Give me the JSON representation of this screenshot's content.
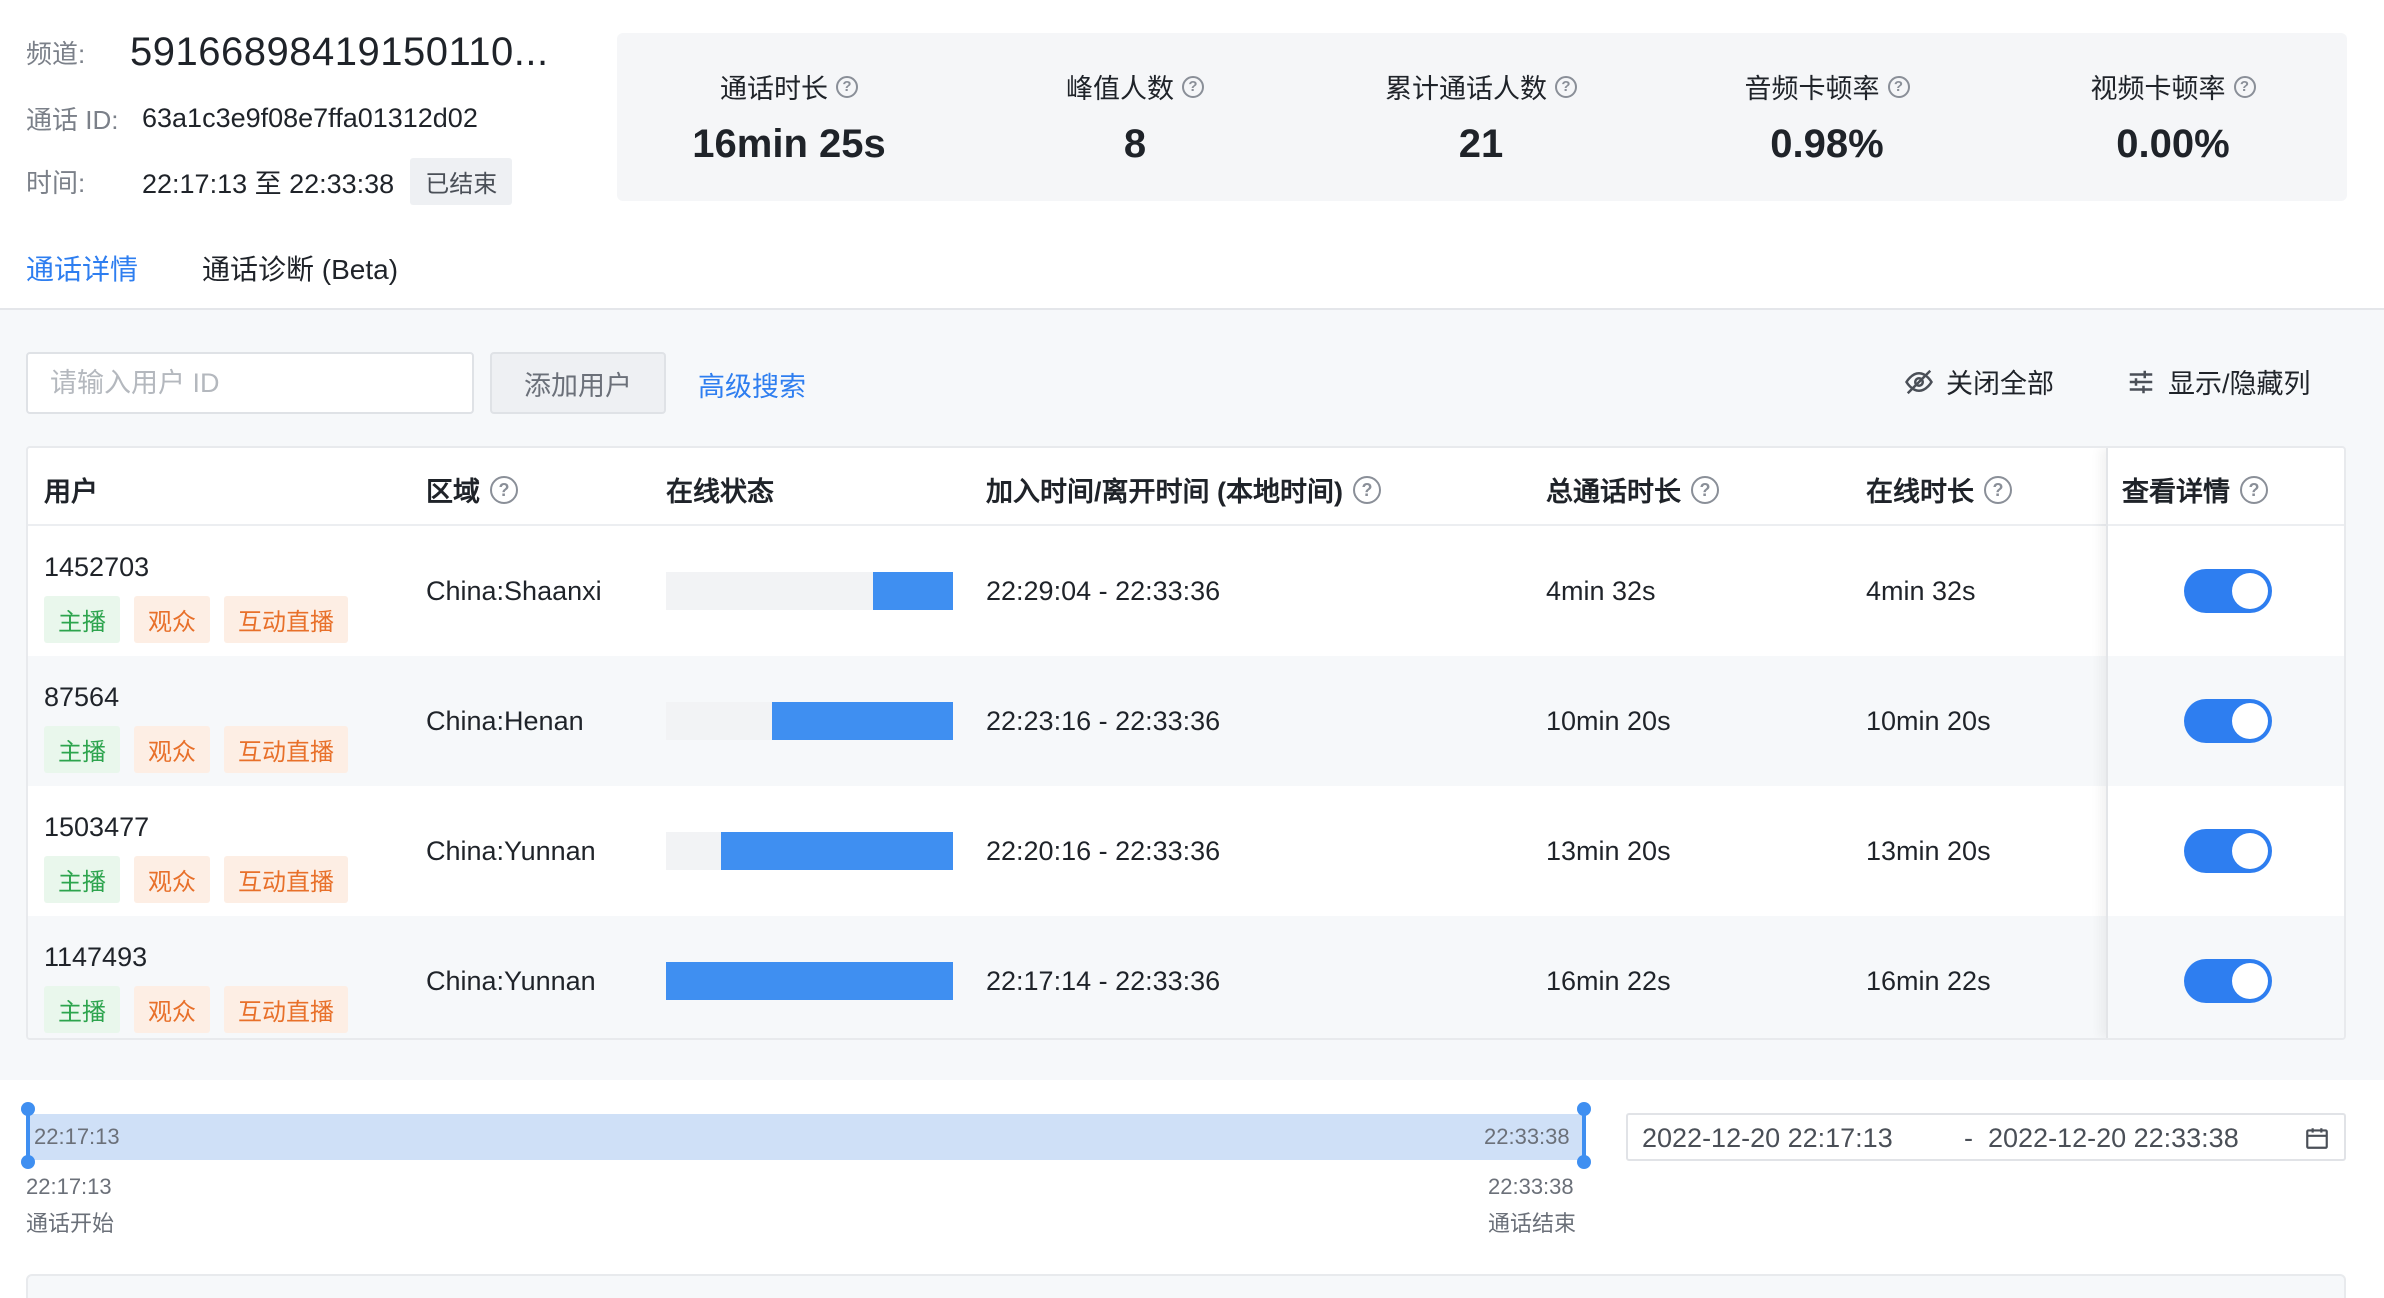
{
  "meta": {
    "channel_label": "频道:",
    "channel_value": "59166898419150110...",
    "call_id_label": "通话 ID:",
    "call_id_value": "63a1c3e9f08e7ffa01312d02",
    "time_label": "时间:",
    "time_value": "22:17:13 至 22:33:38",
    "status": "已结束"
  },
  "stats": [
    {
      "label": "通话时长",
      "value": "16min 25s"
    },
    {
      "label": "峰值人数",
      "value": "8"
    },
    {
      "label": "累计通话人数",
      "value": "21"
    },
    {
      "label": "音频卡顿率",
      "value": "0.98%"
    },
    {
      "label": "视频卡顿率",
      "value": "0.00%"
    }
  ],
  "tabs": [
    {
      "label": "通话详情",
      "active": true
    },
    {
      "label": "通话诊断 (Beta)",
      "active": false
    }
  ],
  "toolbar": {
    "search_placeholder": "请输入用户 ID",
    "add_user": "添加用户",
    "advanced_search": "高级搜索",
    "close_all": "关闭全部",
    "show_hide_columns": "显示/隐藏列"
  },
  "table": {
    "headers": {
      "user": "用户",
      "region": "区域",
      "online_status": "在线状态",
      "join_leave": "加入时间/离开时间 (本地时间)",
      "total_duration": "总通话时长",
      "online_duration": "在线时长",
      "details": "查看详情"
    },
    "rows": [
      {
        "user": "1452703",
        "tags": [
          "主播",
          "观众",
          "互动直播"
        ],
        "region": "China:Shaanxi",
        "online_fraction": 0.28,
        "join_leave": "22:29:04 - 22:33:36",
        "total": "4min 32s",
        "online": "4min 32s",
        "details_on": true
      },
      {
        "user": "87564",
        "tags": [
          "主播",
          "观众",
          "互动直播"
        ],
        "region": "China:Henan",
        "online_fraction": 0.63,
        "join_leave": "22:23:16 - 22:33:36",
        "total": "10min 20s",
        "online": "10min 20s",
        "details_on": true
      },
      {
        "user": "1503477",
        "tags": [
          "主播",
          "观众",
          "互动直播"
        ],
        "region": "China:Yunnan",
        "online_fraction": 0.81,
        "join_leave": "22:20:16 - 22:33:36",
        "total": "13min 20s",
        "online": "13min 20s",
        "details_on": true
      },
      {
        "user": "1147493",
        "tags": [
          "主播",
          "观众",
          "互动直播"
        ],
        "region": "China:Yunnan",
        "online_fraction": 1.0,
        "join_leave": "22:17:14 - 22:33:36",
        "total": "16min 22s",
        "online": "16min 22s",
        "details_on": true
      }
    ]
  },
  "timeline": {
    "range_start": "22:17:13",
    "range_end": "22:33:38",
    "start_time": "22:17:13",
    "start_label": "通话开始",
    "end_time": "22:33:38",
    "end_label": "通话结束"
  },
  "date_range": {
    "start": "2022-12-20 22:17:13",
    "separator": "-",
    "end": "2022-12-20 22:33:38"
  },
  "colors": {
    "accent": "#2e7ef0",
    "bar": "#3f8ff1",
    "tag_green": "#2da44e",
    "tag_orange": "#e8702a"
  },
  "icons": {
    "help": "question-circle-icon",
    "close_all": "eye-slash-icon",
    "columns": "sliders-icon",
    "calendar": "calendar-icon"
  }
}
